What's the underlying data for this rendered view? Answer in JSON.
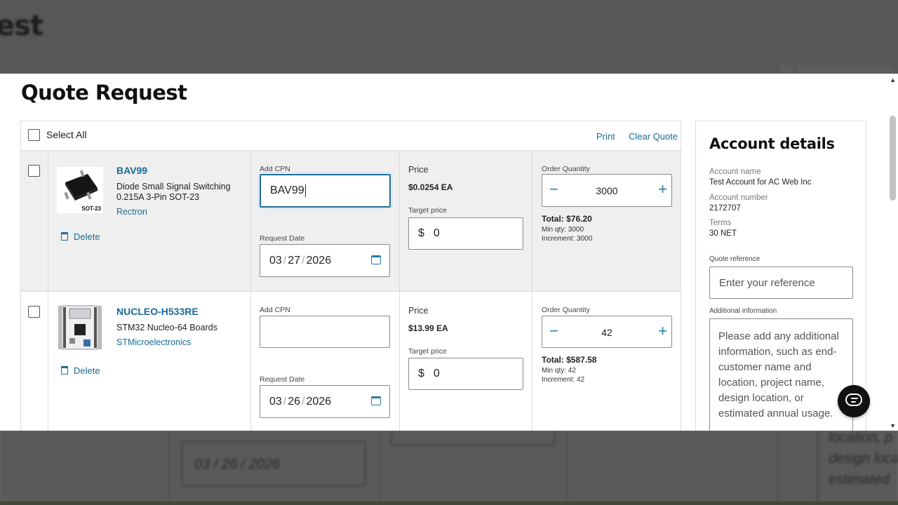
{
  "background": {
    "title": "est",
    "date_value": "03 / 26 / 2026",
    "info_lines": [
      "location, p",
      "design loca",
      "estimated"
    ]
  },
  "modal": {
    "title": "Quote Request",
    "select_all": "Select All",
    "print": "Print",
    "clear_quote": "Clear Quote",
    "labels": {
      "add_cpn": "Add CPN",
      "request_date": "Request Date",
      "price": "Price",
      "target_price": "Target price",
      "order_quantity": "Order Quantity",
      "delete": "Delete",
      "currency": "$"
    },
    "items": [
      {
        "part_number": "BAV99",
        "description": "Diode Small Signal Switching 0.215A 3-Pin SOT-23",
        "manufacturer": "Rectron",
        "image_caption": "SOT-23",
        "cpn": "BAV99",
        "date_mm": "03",
        "date_dd": "27",
        "date_yyyy": "2026",
        "price": "$0.0254 EA",
        "target_price": "0",
        "quantity": "3000",
        "total": "Total: $76.20",
        "min_qty": "Min qty: 3000",
        "increment": "Increment: 3000"
      },
      {
        "part_number": "NUCLEO-H533RE",
        "description": "STM32 Nucleo-64 Boards",
        "manufacturer": "STMicroelectronics",
        "image_caption": "",
        "cpn": "",
        "date_mm": "03",
        "date_dd": "26",
        "date_yyyy": "2026",
        "price": "$13.99 EA",
        "target_price": "0",
        "quantity": "42",
        "total": "Total: $587.58",
        "min_qty": "Min qty: 42",
        "increment": "Increment: 42"
      }
    ]
  },
  "account": {
    "title": "Account details",
    "name_label": "Account name",
    "name_value": "Test Account for AC Web Inc",
    "number_label": "Account number",
    "number_value": "2172707",
    "terms_label": "Terms",
    "terms_value": "30 NET",
    "quote_ref_label": "Quote reference",
    "quote_ref_placeholder": "Enter your reference",
    "addl_label": "Additional information",
    "addl_placeholder": "Please add any additional information, such as end-customer name and location, project name, design location, or estimated annual usage."
  },
  "colors": {
    "link": "#1a6b96",
    "row_highlight": "#efefef"
  },
  "icons": [
    "checkbox-icon",
    "trash-icon",
    "calendar-icon",
    "minus-icon",
    "plus-icon",
    "chat-icon"
  ]
}
